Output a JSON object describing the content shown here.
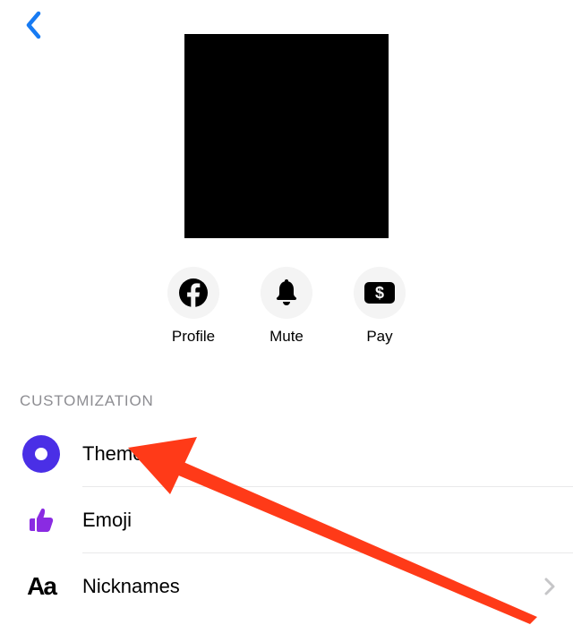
{
  "header": {
    "back": "Back"
  },
  "actions": {
    "items": [
      {
        "label": "Profile",
        "icon": "facebook"
      },
      {
        "label": "Mute",
        "icon": "bell"
      },
      {
        "label": "Pay",
        "icon": "pay"
      }
    ]
  },
  "sections": {
    "customization": {
      "heading": "CUSTOMIZATION",
      "items": [
        {
          "label": "Theme",
          "icon": "theme-swatch",
          "swatch_color": "#4a2fe6"
        },
        {
          "label": "Emoji",
          "icon": "thumbs-up",
          "icon_color": "#8a2be2"
        },
        {
          "label": "Nicknames",
          "icon": "aa",
          "show_chevron": true
        }
      ]
    }
  },
  "annotation": {
    "arrow_color": "#ff3a18",
    "target": "Theme"
  }
}
